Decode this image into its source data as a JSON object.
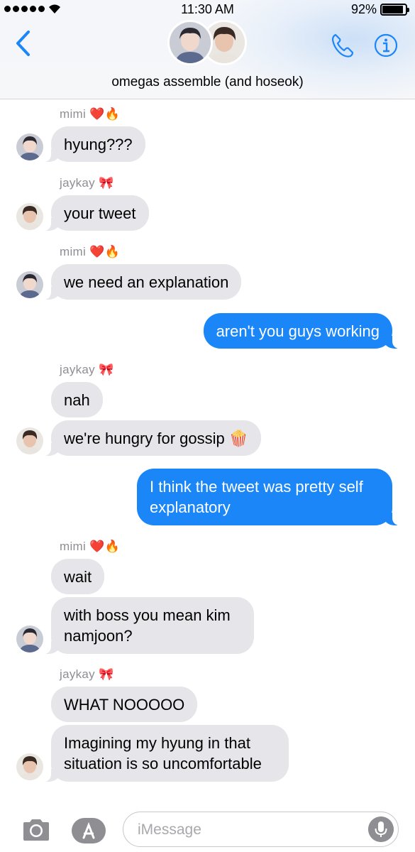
{
  "status_bar": {
    "time": "11:30 AM",
    "battery": "92%",
    "battery_level": 0.92
  },
  "header": {
    "group_name": "omegas assemble (and hoseok)",
    "icons": [
      "chevron-left-icon",
      "phone-icon",
      "info-icon"
    ]
  },
  "messages": [
    {
      "sender": "mimi",
      "sender_emoji": "❤️🔥",
      "direction": "incoming",
      "text": "hyung???"
    },
    {
      "sender": "jaykay",
      "sender_emoji": "🎀",
      "direction": "incoming",
      "text": "your tweet"
    },
    {
      "sender": "mimi",
      "sender_emoji": "❤️🔥",
      "direction": "incoming",
      "text": "we need an explanation"
    },
    {
      "direction": "outgoing",
      "text": "aren't you guys working"
    },
    {
      "sender": "jaykay",
      "sender_emoji": "🎀",
      "direction": "incoming",
      "text": "nah"
    },
    {
      "direction": "incoming",
      "text": "we're hungry for gossip 🍿"
    },
    {
      "direction": "outgoing",
      "lines": [
        "I think the tweet was pretty self",
        "explanatory"
      ]
    },
    {
      "sender": "mimi",
      "sender_emoji": "❤️🔥",
      "direction": "incoming",
      "text": "wait"
    },
    {
      "direction": "incoming",
      "lines": [
        "with boss you mean kim",
        "namjoon?"
      ]
    },
    {
      "sender": "jaykay",
      "sender_emoji": "🎀",
      "direction": "incoming",
      "text": "WHAT NOOOOO"
    },
    {
      "direction": "incoming",
      "lines": [
        "Imagining my hyung in that",
        "situation is so uncomfortable"
      ]
    }
  ],
  "input": {
    "placeholder": "iMessage"
  },
  "colors": {
    "outgoing_bubble": "#1a86f8",
    "incoming_bubble": "#e5e5ea",
    "accent": "#1a86f8"
  }
}
